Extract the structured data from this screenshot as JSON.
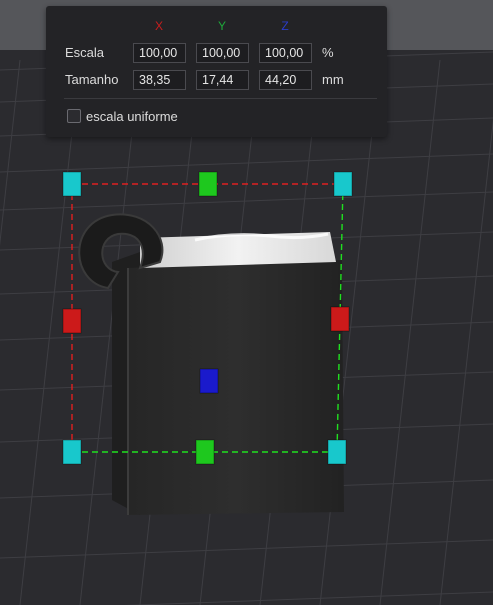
{
  "colors": {
    "axis_x": "#c81e1e",
    "axis_y": "#1ea83a",
    "axis_z": "#2a3cc8",
    "handle_corner": "#18c8cc",
    "handle_x": "#cc1a1a",
    "handle_y": "#1ec81e",
    "handle_z": "#1a1acc",
    "bbox_x_line": "#e02020",
    "bbox_y_line": "#20e020"
  },
  "transform_panel": {
    "axes": {
      "x": "X",
      "y": "Y",
      "z": "Z"
    },
    "scale": {
      "label": "Escala",
      "x": "100,00",
      "y": "100,00",
      "z": "100,00",
      "unit": "%"
    },
    "size": {
      "label": "Tamanho",
      "x": "38,35",
      "y": "17,44",
      "z": "44,20",
      "unit": "mm"
    },
    "uniform_scale": {
      "label": "escala uniforme",
      "checked": false
    }
  }
}
